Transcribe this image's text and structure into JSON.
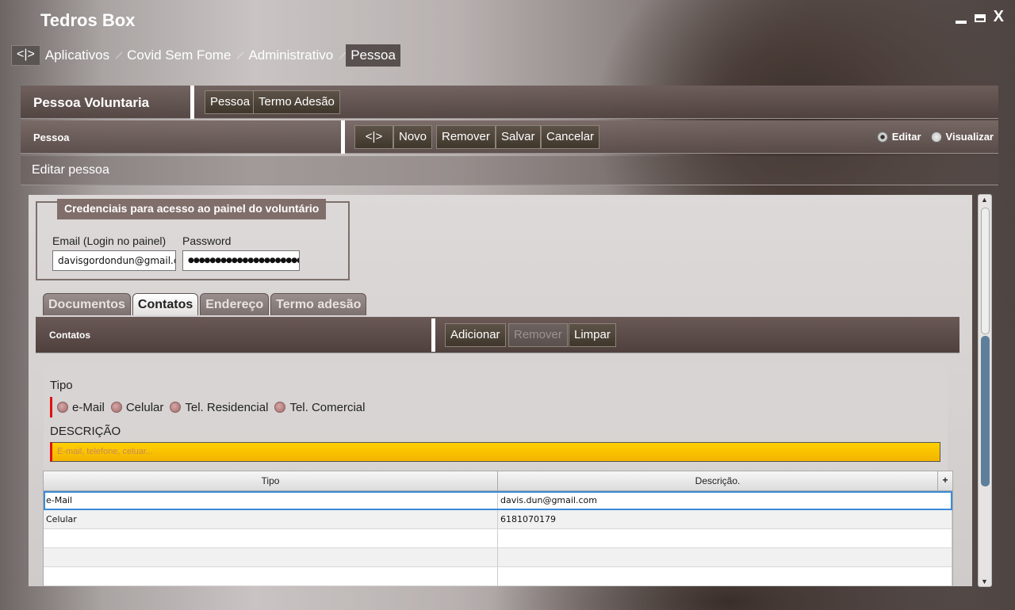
{
  "app": {
    "title": "Tedros Box"
  },
  "window_controls": {
    "close": "X"
  },
  "breadcrumb": {
    "home": "<|>",
    "items": [
      "Aplicativos",
      "Covid Sem Fome",
      "Administrativo",
      "Pessoa"
    ]
  },
  "section": {
    "title": "Pessoa Voluntaria",
    "tabs": [
      "Pessoa",
      "Termo Adesão"
    ]
  },
  "toolbar": {
    "title": "Pessoa",
    "buttons": {
      "nav": "<|>",
      "novo": "Novo",
      "remover": "Remover",
      "salvar": "Salvar",
      "cancelar": "Cancelar"
    },
    "mode": {
      "editar": "Editar",
      "visualizar": "Visualizar",
      "selected": "Editar"
    }
  },
  "subheader": {
    "title": "Editar pessoa"
  },
  "credentials": {
    "title": "Credenciais para acesso ao painel do voluntário",
    "email_label": "Email (Login no painel)",
    "email_value": "davisgordondun@gmail.cc",
    "password_label": "Password",
    "password_value": "●●●●●●●●●●●●●●●●●●●●●"
  },
  "inner_tabs": {
    "items": [
      "Documentos",
      "Contatos",
      "Endereço",
      "Termo adesão"
    ],
    "active": "Contatos"
  },
  "contatos": {
    "title": "Contatos",
    "buttons": {
      "adicionar": "Adicionar",
      "remover": "Remover",
      "limpar": "Limpar"
    },
    "tipo_label": "Tipo",
    "tipo_options": [
      "e-Mail",
      "Celular",
      "Tel. Residencial",
      "Tel. Comercial"
    ],
    "descricao_label": "DESCRIÇÃO",
    "descricao_placeholder": "E-mail, telefone, celuar..."
  },
  "table": {
    "columns": [
      "Tipo",
      "Descrição."
    ],
    "add_column": "+",
    "rows": [
      {
        "tipo": "e-Mail",
        "descricao": "davis.dun@gmail.com"
      },
      {
        "tipo": "Celular",
        "descricao": "6181070179"
      }
    ]
  },
  "colors": {
    "required_marker": "#e01010",
    "field_highlight": "#ffd000",
    "selection": "#3b8bd6"
  }
}
